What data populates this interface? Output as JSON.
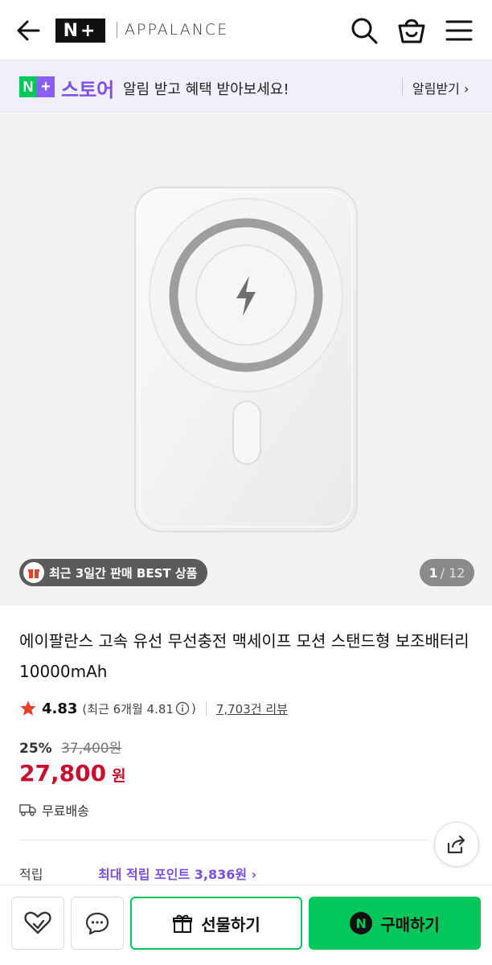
{
  "header": {
    "logo_text": "N+",
    "brand": "APPALANCE",
    "icons": [
      "back-arrow-icon",
      "search-icon",
      "cart-icon",
      "menu-icon"
    ]
  },
  "banner": {
    "badge_n": "N",
    "badge_plus": "+",
    "store_word": "스토어",
    "message": "알림 받고 혜택 받아보세요!",
    "link_label": "알림받기 ›"
  },
  "gallery": {
    "best_badge": "최근 3일간 판매 BEST 상품",
    "current_page": "1",
    "total_pages": "/ 12"
  },
  "product": {
    "title": "에이팔란스 고속 유선 무선충전 맥세이프 모션 스탠드형 보조배터리 10000mAh",
    "rating": "4.83",
    "recent_rating": "(최근 6개월 4.81",
    "recent_close": ")",
    "review_count": "7,703건 리뷰",
    "discount_pct": "25%",
    "original_price": "37,400원",
    "price": "27,800",
    "price_unit": "원",
    "shipping": "무료배송",
    "points_label": "적립",
    "points_value": "최대 적립 포인트 3,836원 ›"
  },
  "bottom_bar": {
    "gift_label": "선물하기",
    "buy_label": "구매하기",
    "npay_letter": "N"
  },
  "colors": {
    "naver_green": "#03c75a",
    "store_purple": "#7b4ee4",
    "price_red": "#c8102e",
    "star_red": "#e8402a"
  }
}
